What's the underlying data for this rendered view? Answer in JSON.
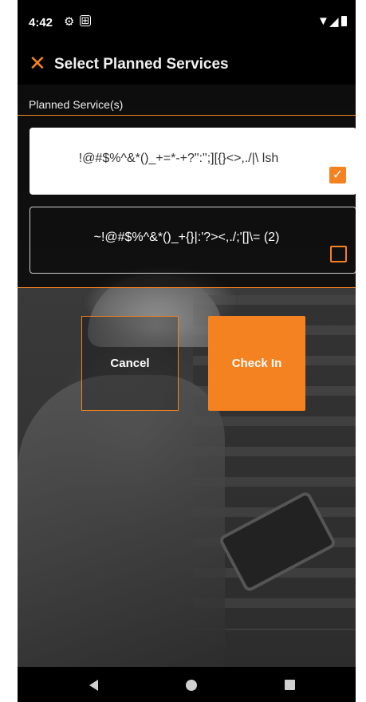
{
  "status_bar": {
    "time": "4:42",
    "icons": [
      "gear-icon",
      "screenshot-icon",
      "wifi-icon",
      "signal-icon",
      "battery-icon"
    ]
  },
  "app_bar": {
    "title": "Select Planned Services",
    "close_icon": "close-icon"
  },
  "section": {
    "label": "Planned Service(s)"
  },
  "services": [
    {
      "name": "!@#$%^&*()_+=*-+?\":\";][{}<>,./|\\ lsh",
      "checked": true
    },
    {
      "name": "~!@#$%^&*()_+{}|:'?><,./;'[]\\= (2)",
      "checked": false
    }
  ],
  "buttons": {
    "cancel": "Cancel",
    "check_in": "Check In"
  },
  "colors": {
    "accent": "#f58220",
    "background": "#1a1a1a"
  }
}
